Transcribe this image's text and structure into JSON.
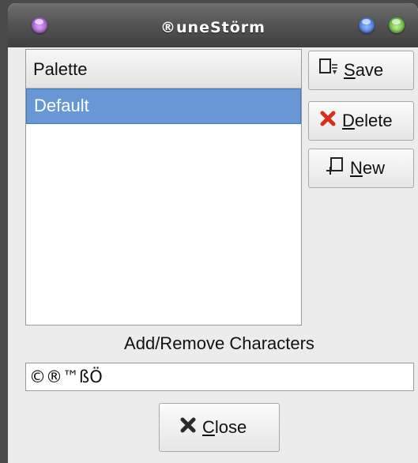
{
  "window": {
    "title": "®uneStörm"
  },
  "palette_list": {
    "header": "Palette",
    "items": [
      {
        "label": "Default",
        "selected": true
      }
    ]
  },
  "buttons": {
    "save": {
      "mnemonic": "S",
      "rest": "ave",
      "icon": "save-icon"
    },
    "delete": {
      "mnemonic": "D",
      "rest": "elete",
      "icon": "delete-x-icon"
    },
    "new": {
      "mnemonic": "N",
      "rest": "ew",
      "icon": "new-icon"
    },
    "close": {
      "mnemonic": "C",
      "rest": "lose",
      "icon": "close-x-icon"
    }
  },
  "characters": {
    "label": "Add/Remove Characters",
    "value": "©®™ßÖ"
  },
  "colors": {
    "selection": "#6897d6",
    "delete_icon": "#d8301c",
    "title_text": "#ffffff"
  }
}
